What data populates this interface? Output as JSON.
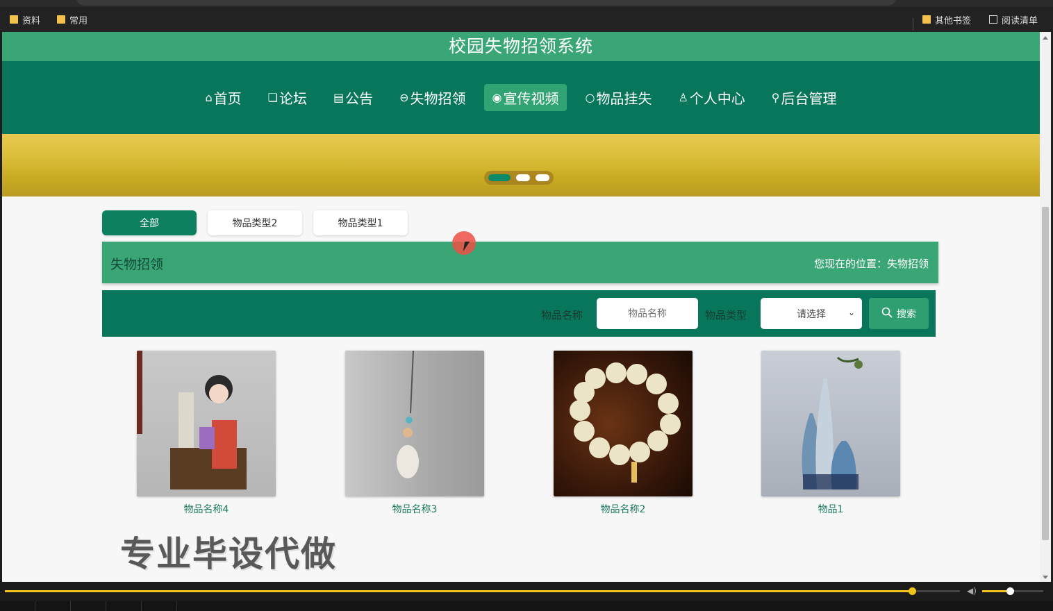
{
  "bookmarks": {
    "left": [
      {
        "label": "资料",
        "icon": "folder-icon"
      },
      {
        "label": "常用",
        "icon": "folder-icon"
      }
    ],
    "right": [
      {
        "label": "其他书签",
        "icon": "folder-icon"
      },
      {
        "label": "阅读清单",
        "icon": "reading-list-icon"
      }
    ]
  },
  "site": {
    "title": "校园失物招领系统"
  },
  "nav": {
    "items": [
      {
        "icon": "⌂",
        "label": "首页"
      },
      {
        "icon": "❏",
        "label": "论坛"
      },
      {
        "icon": "▤",
        "label": "公告"
      },
      {
        "icon": "⊖",
        "label": "失物招领"
      },
      {
        "icon": "◉",
        "label": "宣传视频"
      },
      {
        "icon": "○",
        "label": "物品挂失"
      },
      {
        "icon": "♙",
        "label": "个人中心"
      },
      {
        "icon": "⚲",
        "label": "后台管理"
      }
    ],
    "active_index": 4
  },
  "banner": {
    "dots": 3,
    "active_dot": 0
  },
  "category_tabs": {
    "items": [
      "全部",
      "物品类型2",
      "物品类型1"
    ],
    "active_index": 0
  },
  "breadcrumb": {
    "title": "失物招领",
    "position": "您现在的位置：失物招领"
  },
  "search": {
    "name_label": "物品名称",
    "name_placeholder": "物品名称",
    "type_label": "物品类型",
    "type_selected": "请选择",
    "button_label": "搜索"
  },
  "items": [
    {
      "name": "物品名称4"
    },
    {
      "name": "物品名称3"
    },
    {
      "name": "物品名称2"
    },
    {
      "name": "物品1"
    }
  ],
  "watermark": {
    "text": "专业毕设代做"
  },
  "player": {
    "progress": 0.95,
    "volume": 0.45
  },
  "colors": {
    "title_bar": "#3aa676",
    "nav_bg": "#07765a",
    "accent": "#0d8060",
    "player_accent": "#f2c318"
  }
}
